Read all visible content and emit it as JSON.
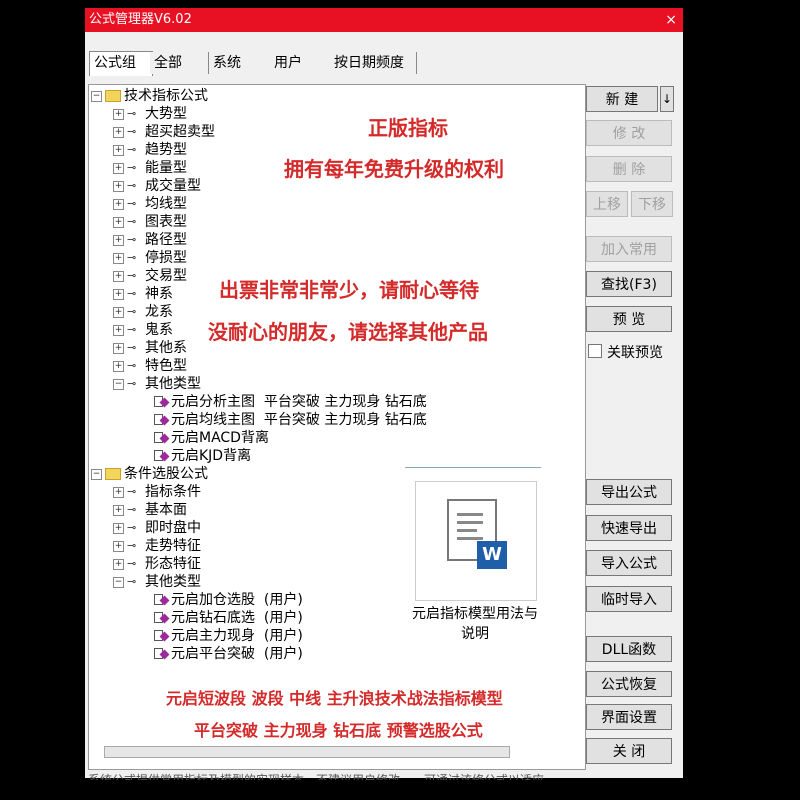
{
  "window": {
    "title": "公式管理器V6.02",
    "close_glyph": "×"
  },
  "tabs": [
    "公式组",
    "全部",
    "系统",
    "用户",
    "按日期频度"
  ],
  "tree": {
    "group1": "技术指标公式",
    "group1_items": [
      "大势型",
      "超买超卖型",
      "趋势型",
      "能量型",
      "成交量型",
      "均线型",
      "图表型",
      "路径型",
      "停损型",
      "交易型",
      "神系",
      "龙系",
      "鬼系",
      "其他系",
      "特色型",
      "其他类型"
    ],
    "group1_formulas": [
      "元启分析主图  平台突破 主力现身 钻石底",
      "元启均线主图  平台突破 主力现身 钻石底",
      "元启MACD背离",
      "元启KJD背离"
    ],
    "group2": "条件选股公式",
    "group2_items": [
      "指标条件",
      "基本面",
      "即时盘中",
      "走势特征",
      "形态特征",
      "其他类型"
    ],
    "group2_formulas": [
      "元启加仓选股  (用户)",
      "元启钻石底选  (用户)",
      "元启主力现身  (用户)",
      "元启平台突破  (用户)"
    ]
  },
  "promo": {
    "line1": "正版指标",
    "line2": "拥有每年免费升级的权利",
    "line3": "出票非常非常少，请耐心等待",
    "line4": "没耐心的朋友，请选择其他产品",
    "line5": "元启短波段 波段 中线 主升浪技术战法指标模型",
    "line6": "平台突破 主力现身 钻石底 预警选股公式"
  },
  "doc_card": {
    "badge": "W",
    "caption": "元启指标模型用法与说明"
  },
  "buttons": {
    "new": "新  建",
    "new_arrow": "↓",
    "modify": "修  改",
    "delete": "删  除",
    "move_up": "上移",
    "move_down": "下移",
    "add_common": "加入常用",
    "find": "查找(F3)",
    "preview": "预  览",
    "link_preview": "关联预览",
    "export": "导出公式",
    "quick_export": "快速导出",
    "import": "导入公式",
    "temp_import": "临时导入",
    "dll": "DLL函数",
    "restore": "公式恢复",
    "ui_settings": "界面设置",
    "close": "关  闭"
  },
  "status_text": "系统公式提供常用指标及模型的实现样本，不建议用户修改……可通过该修公式以适应"
}
